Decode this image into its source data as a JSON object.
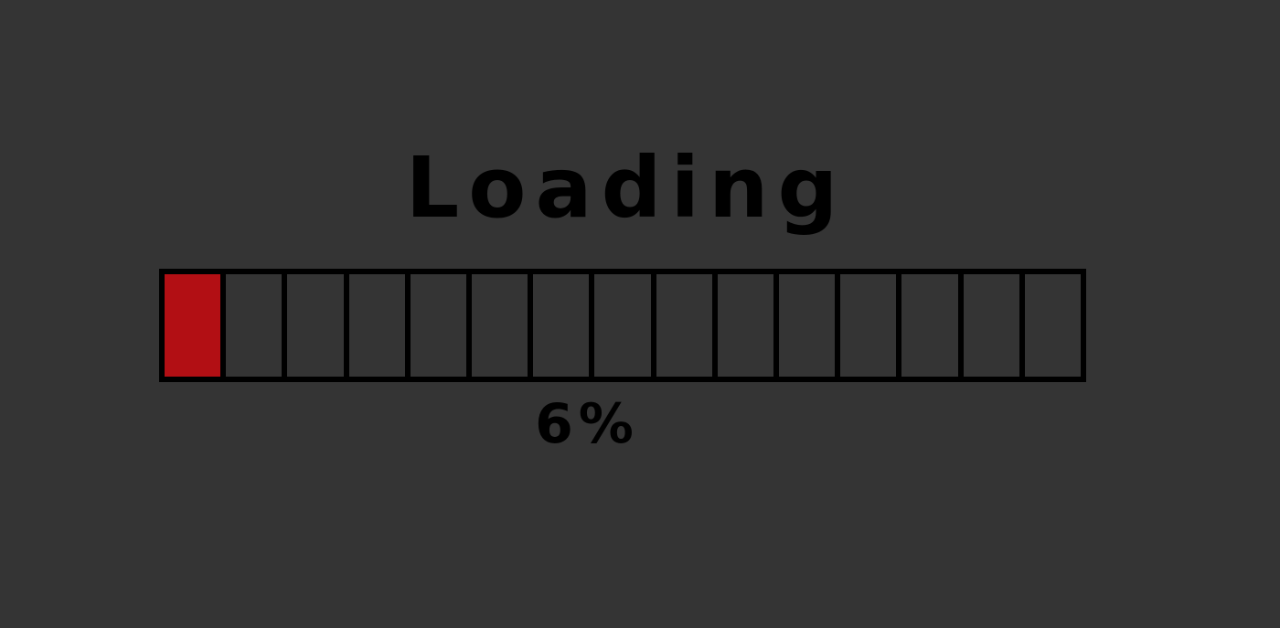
{
  "loader": {
    "title": "Loading",
    "percent_label": "6%",
    "progress_fraction": 0.06,
    "segment_count": 15,
    "filled_segments": 1,
    "colors": {
      "background": "#343434",
      "fill": "#b20f14",
      "outline": "#000000",
      "text": "#000000"
    }
  }
}
